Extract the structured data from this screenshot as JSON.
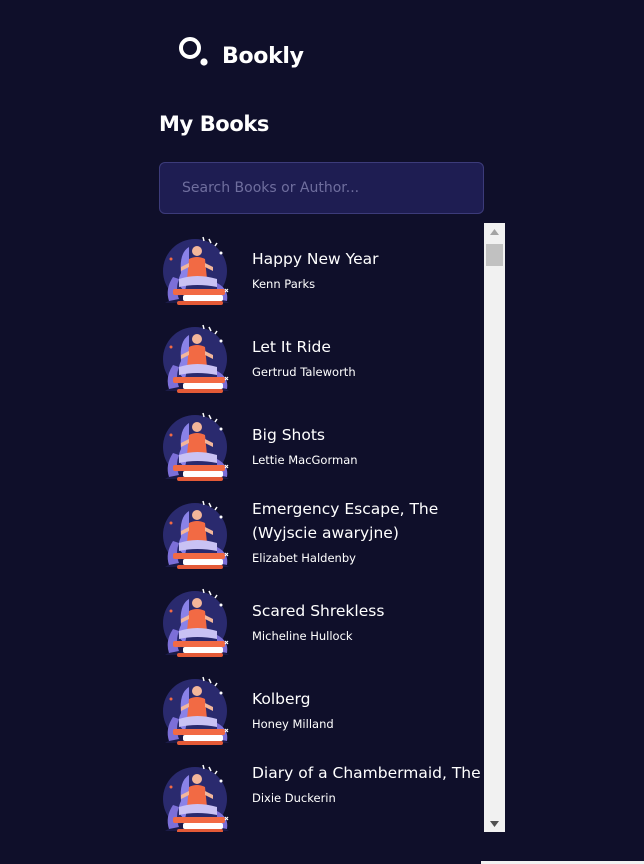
{
  "brand": {
    "name": "Bookly",
    "logo_icon": "search-icon"
  },
  "page": {
    "title": "My Books"
  },
  "search": {
    "placeholder": "Search Books or Author..."
  },
  "colors": {
    "background": "#0f0f2a",
    "search_bg": "#1e1d52",
    "accent_orange": "#f26a44",
    "accent_purple": "#7c6fd8"
  },
  "books": [
    {
      "title": "Happy New Year",
      "author": "Kenn Parks",
      "cover_icon": "book-cover-illustration"
    },
    {
      "title": "Let It Ride",
      "author": "Gertrud Taleworth",
      "cover_icon": "book-cover-illustration"
    },
    {
      "title": "Big Shots",
      "author": "Lettie MacGorman",
      "cover_icon": "book-cover-illustration"
    },
    {
      "title": "Emergency Escape, The (Wyjscie awaryjne)",
      "author": "Elizabet Haldenby",
      "cover_icon": "book-cover-illustration"
    },
    {
      "title": "Scared Shrekless",
      "author": "Micheline Hullock",
      "cover_icon": "book-cover-illustration"
    },
    {
      "title": "Kolberg",
      "author": "Honey Milland",
      "cover_icon": "book-cover-illustration"
    },
    {
      "title": "Diary of a Chambermaid, The",
      "author": "Dixie Duckerin",
      "cover_icon": "book-cover-illustration"
    }
  ]
}
